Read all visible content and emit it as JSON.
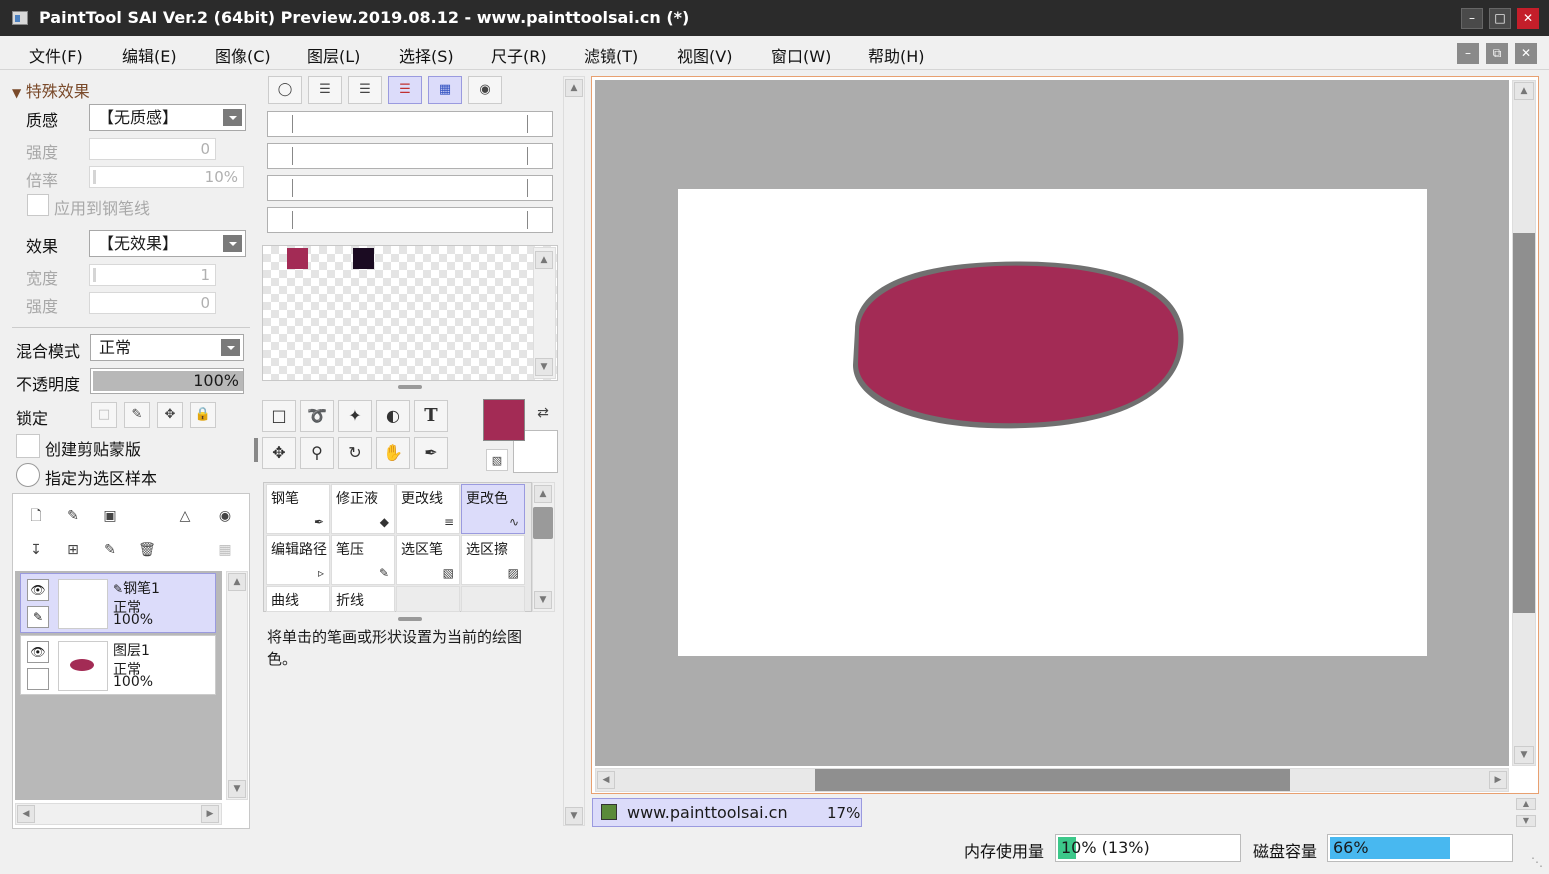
{
  "window": {
    "title": "PaintTool SAI Ver.2 (64bit) Preview.2019.08.12 - www.painttoolsai.cn (*)",
    "buttons": [
      "minimize",
      "maximize",
      "close"
    ]
  },
  "menu": [
    "文件(F)",
    "编辑(E)",
    "图像(C)",
    "图层(L)",
    "选择(S)",
    "尺子(R)",
    "滤镜(T)",
    "视图(V)",
    "窗口(W)",
    "帮助(H)"
  ],
  "effects": {
    "header": "特殊效果",
    "texture_label": "质感",
    "texture_value": "【无质感】",
    "strength_label": "强度",
    "strength_value": "0",
    "scale_label": "倍率",
    "scale_value": "10%",
    "apply_pen_label": "应用到钢笔线",
    "effect_label": "效果",
    "effect_value": "【无效果】",
    "width_label": "宽度",
    "width_value": "1",
    "strength2_label": "强度",
    "strength2_value": "0"
  },
  "layer_props": {
    "blend_label": "混合模式",
    "blend_value": "正常",
    "opacity_label": "不透明度",
    "opacity_value": "100%",
    "opacity_fraction": 1.0,
    "lock_label": "锁定",
    "clip_label": "创建剪贴蒙版",
    "selsource_label": "指定为选区样本"
  },
  "layers": [
    {
      "name": "钢笔1",
      "mode": "正常",
      "opacity": "100%",
      "selected": true
    },
    {
      "name": "图层1",
      "mode": "正常",
      "opacity": "100%",
      "selected": false
    }
  ],
  "palette": {
    "swatch1": "#a32b55",
    "swatch2": "#1b0b22"
  },
  "colors": {
    "foreground": "#a32b55",
    "background": "#ffffff",
    "canvas_bg": "#acacac",
    "accent": "#dcdcfa",
    "ellipse": "#a32b55"
  },
  "brushes": [
    {
      "label": "钢笔",
      "icon": "pen-icon"
    },
    {
      "label": "修正液",
      "icon": "eraser-icon"
    },
    {
      "label": "更改线",
      "icon": "lines-icon"
    },
    {
      "label": "更改色",
      "icon": "recolor-icon",
      "selected": true
    },
    {
      "label": "编辑路径",
      "icon": "cursor-icon"
    },
    {
      "label": "笔压",
      "icon": "pressure-icon"
    },
    {
      "label": "选区笔",
      "icon": "selpen-icon"
    },
    {
      "label": "选区擦",
      "icon": "selerase-icon"
    },
    {
      "label": "曲线",
      "icon": ""
    },
    {
      "label": "折线",
      "icon": ""
    }
  ],
  "tool_hint": "将单击的笔画或形状设置为当前的绘图色。",
  "document": {
    "name": "www.painttoolsai.cn",
    "zoom": "17%"
  },
  "status": {
    "memory_label": "内存使用量",
    "memory_value": "10% (13%)",
    "memory_fraction": 0.1,
    "disk_label": "磁盘容量",
    "disk_value": "66%",
    "disk_fraction": 0.66
  }
}
